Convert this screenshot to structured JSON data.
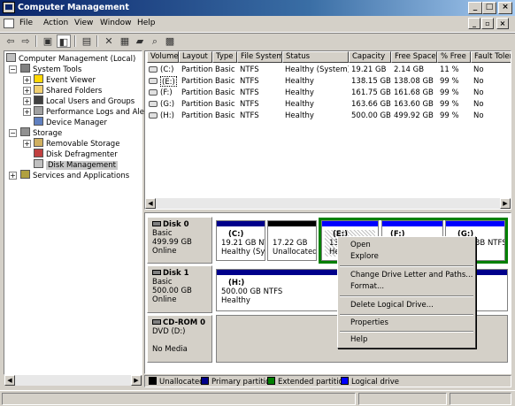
{
  "window": {
    "title": "Computer Management"
  },
  "menubar": {
    "file": "File",
    "action": "Action",
    "view": "View",
    "window": "Window",
    "help": "Help"
  },
  "tree": {
    "root": "Computer Management (Local)",
    "system_tools": "System Tools",
    "event_viewer": "Event Viewer",
    "shared_folders": "Shared Folders",
    "local_users": "Local Users and Groups",
    "perf_logs": "Performance Logs and Alerts",
    "device_manager": "Device Manager",
    "storage": "Storage",
    "removable_storage": "Removable Storage",
    "disk_defrag": "Disk Defragmenter",
    "disk_management": "Disk Management",
    "services": "Services and Applications"
  },
  "volume_table": {
    "headers": [
      "Volume",
      "Layout",
      "Type",
      "File System",
      "Status",
      "Capacity",
      "Free Space",
      "% Free",
      "Fault Toler"
    ],
    "rows": [
      [
        "(C:)",
        "Partition",
        "Basic",
        "NTFS",
        "Healthy (System)",
        "19.21 GB",
        "2.14 GB",
        "11 %",
        "No"
      ],
      [
        "(E:)",
        "Partition",
        "Basic",
        "NTFS",
        "Healthy",
        "138.15 GB",
        "138.08 GB",
        "99 %",
        "No"
      ],
      [
        "(F:)",
        "Partition",
        "Basic",
        "NTFS",
        "Healthy",
        "161.75 GB",
        "161.68 GB",
        "99 %",
        "No"
      ],
      [
        "(G:)",
        "Partition",
        "Basic",
        "NTFS",
        "Healthy",
        "163.66 GB",
        "163.60 GB",
        "99 %",
        "No"
      ],
      [
        "(H:)",
        "Partition",
        "Basic",
        "NTFS",
        "Healthy",
        "500.00 GB",
        "499.92 GB",
        "99 %",
        "No"
      ]
    ]
  },
  "disks": {
    "disk0": {
      "name": "Disk 0",
      "type": "Basic",
      "size": "499.99 GB",
      "status": "Online"
    },
    "disk1": {
      "name": "Disk 1",
      "type": "Basic",
      "size": "500.00 GB",
      "status": "Online"
    },
    "cdrom0": {
      "name": "CD-ROM 0",
      "type": "DVD (D:)",
      "status": "No Media"
    }
  },
  "partitions": {
    "c": {
      "label": "(C:)",
      "info": "19.21 GB NT",
      "status": "Healthy (Sys"
    },
    "unalloc": {
      "size": "17.22 GB",
      "status": "Unallocated"
    },
    "e": {
      "label": "(E:)",
      "info": "138",
      "status": "Hea"
    },
    "f": {
      "label": "(F:)"
    },
    "g": {
      "label": "(G:)",
      "info": "3B NTFS"
    },
    "h": {
      "label": "(H:)",
      "info": "500.00 GB NTFS",
      "status": "Healthy"
    }
  },
  "context_menu": {
    "open": "Open",
    "explore": "Explore",
    "change_letter": "Change Drive Letter and Paths...",
    "format": "Format...",
    "delete": "Delete Logical Drive...",
    "properties": "Properties",
    "help": "Help"
  },
  "legend": {
    "unallocated": "Unallocated",
    "primary": "Primary partition",
    "extended": "Extended partition",
    "logical": "Logical drive"
  },
  "colors": {
    "unallocated": "#000000",
    "primary": "#00008b",
    "extended": "#008000",
    "logical": "#0000ff",
    "selection": "#0a246a"
  }
}
